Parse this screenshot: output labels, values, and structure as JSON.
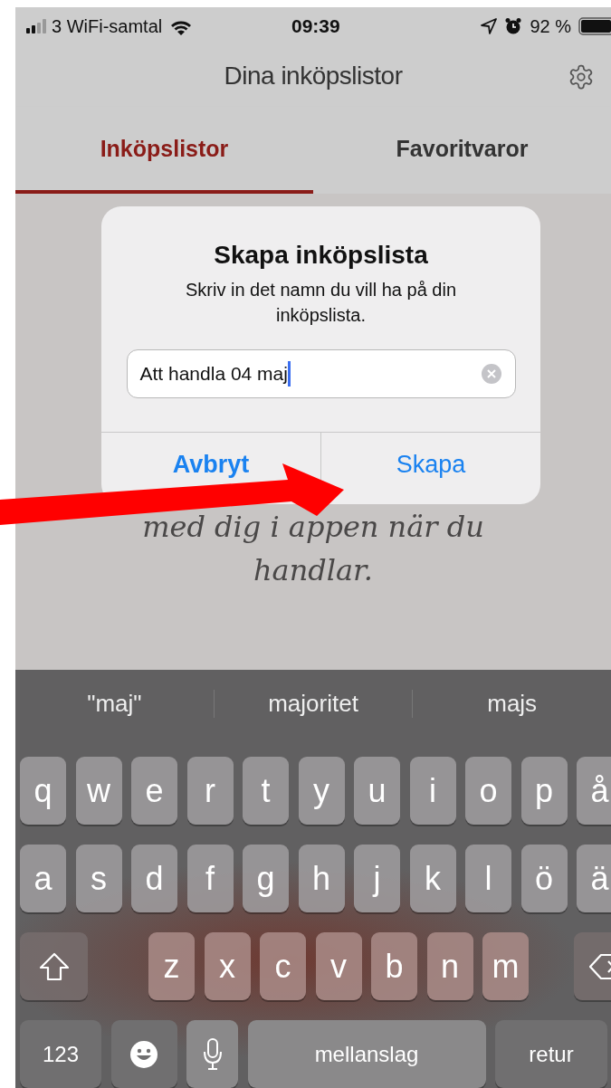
{
  "status_bar": {
    "carrier": "3 WiFi-samtal",
    "time": "09:39",
    "battery": "92 %"
  },
  "header": {
    "title": "Dina inköpslistor"
  },
  "tabs": [
    {
      "label": "Inköpslistor",
      "selected": true
    },
    {
      "label": "Favoritvaror",
      "selected": false
    }
  ],
  "background_text": [
    "med dig i appen när du",
    "handlar."
  ],
  "dialog": {
    "title": "Skapa inköpslista",
    "message": "Skriv in det namn du vill ha på din inköpslista.",
    "field": {
      "value": "Att handla 04 maj"
    },
    "buttons": [
      {
        "label": "Avbryt",
        "kind": "cancel"
      },
      {
        "label": "Skapa",
        "kind": "default"
      }
    ]
  },
  "keyboard": {
    "suggestions": [
      "\"maj\"",
      "majoritet",
      "majs"
    ],
    "rows": [
      [
        "q",
        "w",
        "e",
        "r",
        "t",
        "y",
        "u",
        "i",
        "o",
        "p",
        "å"
      ],
      [
        "a",
        "s",
        "d",
        "f",
        "g",
        "h",
        "j",
        "k",
        "l",
        "ö",
        "ä"
      ],
      [
        "z",
        "x",
        "c",
        "v",
        "b",
        "n",
        "m"
      ]
    ],
    "bottom_row": [
      {
        "label": "123",
        "kind": "numbers"
      },
      {
        "kind": "emoji"
      },
      {
        "kind": "mic"
      },
      {
        "label": "mellanslag",
        "kind": "space"
      },
      {
        "label": "retur",
        "kind": "return"
      }
    ]
  }
}
